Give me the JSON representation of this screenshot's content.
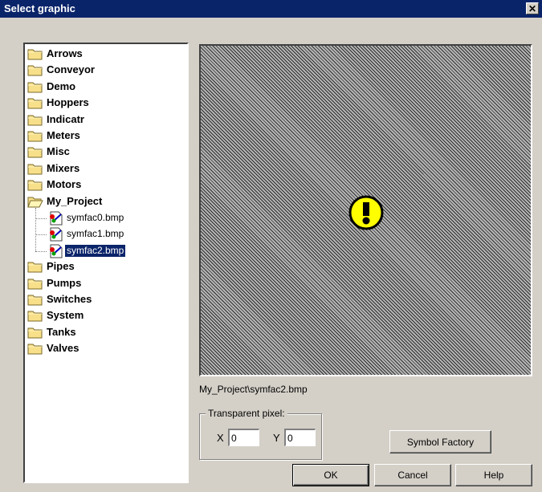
{
  "window": {
    "title": "Select graphic",
    "close_glyph": "✕"
  },
  "tree": {
    "folders": [
      {
        "label": "Arrows"
      },
      {
        "label": "Conveyor"
      },
      {
        "label": "Demo"
      },
      {
        "label": "Hoppers"
      },
      {
        "label": "Indicatr"
      },
      {
        "label": "Meters"
      },
      {
        "label": "Misc"
      },
      {
        "label": "Mixers"
      },
      {
        "label": "Motors"
      },
      {
        "label": "My_Project",
        "expanded": true
      },
      {
        "label": "Pipes"
      },
      {
        "label": "Pumps"
      },
      {
        "label": "Switches"
      },
      {
        "label": "System"
      },
      {
        "label": "Tanks"
      },
      {
        "label": "Valves"
      }
    ],
    "files": [
      {
        "label": "symfac0.bmp",
        "selected": false
      },
      {
        "label": "symfac1.bmp",
        "selected": false
      },
      {
        "label": "symfac2.bmp",
        "selected": true
      }
    ]
  },
  "preview": {
    "path": "My_Project\\symfac2.bmp",
    "icon": "exclamation-icon",
    "icon_color": "#ffff00"
  },
  "transparent_pixel": {
    "legend": "Transparent pixel:",
    "x_label": "X",
    "x_value": "0",
    "y_label": "Y",
    "y_value": "0"
  },
  "buttons": {
    "symbol_factory": "Symbol Factory",
    "ok": "OK",
    "cancel": "Cancel",
    "help": "Help"
  },
  "colors": {
    "title_bar": "#0a246a",
    "dialog_face": "#d4d0c8",
    "selection": "#0a246a"
  }
}
